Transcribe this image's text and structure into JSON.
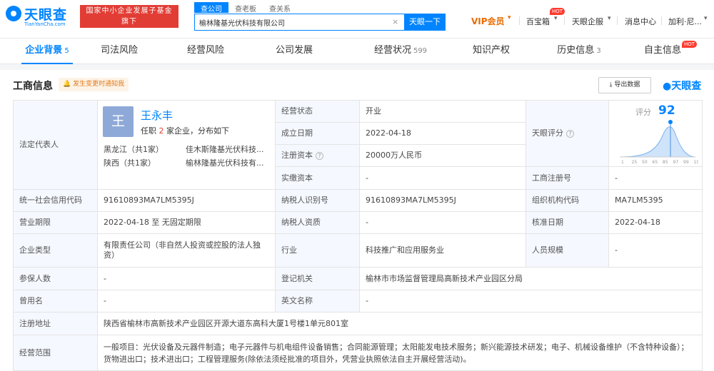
{
  "header": {
    "logo_text": "天眼查",
    "logo_sub": "TianYanCha.com",
    "badge_line1": "国家中小企业发展子基金旗下",
    "badge_line2": "官方备案企业征信机构",
    "search_tabs": [
      "查公司",
      "查老板",
      "查关系"
    ],
    "search_value": "榆林隆基光伏科技有限公司",
    "search_button": "天眼一下",
    "clear_glyph": "×",
    "nav": {
      "vip": "VIP会员",
      "baibaoxiang": "百宝箱",
      "hot": "HOT",
      "enterprise": "天眼企服",
      "messages": "消息中心",
      "user": "加利·尼..."
    },
    "colors": {
      "brand": "#0084ff",
      "red": "#e23d35"
    }
  },
  "tabs": [
    {
      "label": "企业背景",
      "count": "5"
    },
    {
      "label": "司法风险",
      "count": ""
    },
    {
      "label": "经营风险",
      "count": ""
    },
    {
      "label": "公司发展",
      "count": ""
    },
    {
      "label": "经营状况",
      "count": "599"
    },
    {
      "label": "知识产权",
      "count": ""
    },
    {
      "label": "历史信息",
      "count": "3"
    },
    {
      "label": "自主信息",
      "count": ""
    }
  ],
  "tab_hot": "HOT",
  "panel": {
    "title": "工商信息",
    "notify": "发生变更时通知我",
    "export": "导出数据",
    "brand": "天眼查"
  },
  "legal": {
    "label": "法定代表人",
    "avatar": "王",
    "name": "王永丰",
    "sub_prefix": "任职",
    "sub_count": "2",
    "sub_suffix": "家企业，分布如下",
    "regions": [
      {
        "province": "黑龙江（共1家）",
        "company": "佳木斯隆基光伏科技..."
      },
      {
        "province": "陕西（共1家）",
        "company": "榆林隆基光伏科技有..."
      }
    ]
  },
  "rows": {
    "status_label": "经营状态",
    "status": "开业",
    "founded_label": "成立日期",
    "founded": "2022-04-18",
    "capital_label": "注册资本",
    "capital": "20000万人民币",
    "paidin_label": "实缴资本",
    "paidin": "-",
    "score_label": "天眼评分",
    "regno_label": "工商注册号",
    "regno": "-",
    "credit_label": "统一社会信用代码",
    "credit": "91610893MA7LM5395J",
    "taxid_label": "纳税人识别号",
    "taxid": "91610893MA7LM5395J",
    "orgcode_label": "组织机构代码",
    "orgcode": "MA7LM5395",
    "term_label": "营业期限",
    "term": "2022-04-18 至 无固定期限",
    "taxq_label": "纳税人资质",
    "taxq": "-",
    "approve_label": "核准日期",
    "approve": "2022-04-18",
    "type_label": "企业类型",
    "type": "有限责任公司（非自然人投资或控股的法人独资）",
    "industry_label": "行业",
    "industry": "科技推广和应用服务业",
    "staff_label": "人员规模",
    "staff": "-",
    "insured_label": "参保人数",
    "insured": "-",
    "authority_label": "登记机关",
    "authority": "榆林市市场监督管理局高新技术产业园区分局",
    "former_label": "曾用名",
    "former": "-",
    "english_label": "英文名称",
    "english": "-",
    "address_label": "注册地址",
    "address": "陕西省榆林市高新技术产业园区开源大道东高科大厦1号楼1单元801室",
    "scope_label": "经营范围",
    "scope": "一般项目：光伏设备及元器件制造；电子元器件与机电组件设备销售；合同能源管理；太阳能发电技术服务；新兴能源技术研发；电子、机械设备维护（不含特种设备）；货物进出口；技术进出口；工程管理服务(除依法须经批准的项目外，凭营业执照依法自主开展经营活动)。"
  },
  "score": {
    "label": "评分",
    "value": "92",
    "ticks": [
      "1",
      "25",
      "50",
      "65",
      "85",
      "97",
      "99",
      "100"
    ]
  }
}
